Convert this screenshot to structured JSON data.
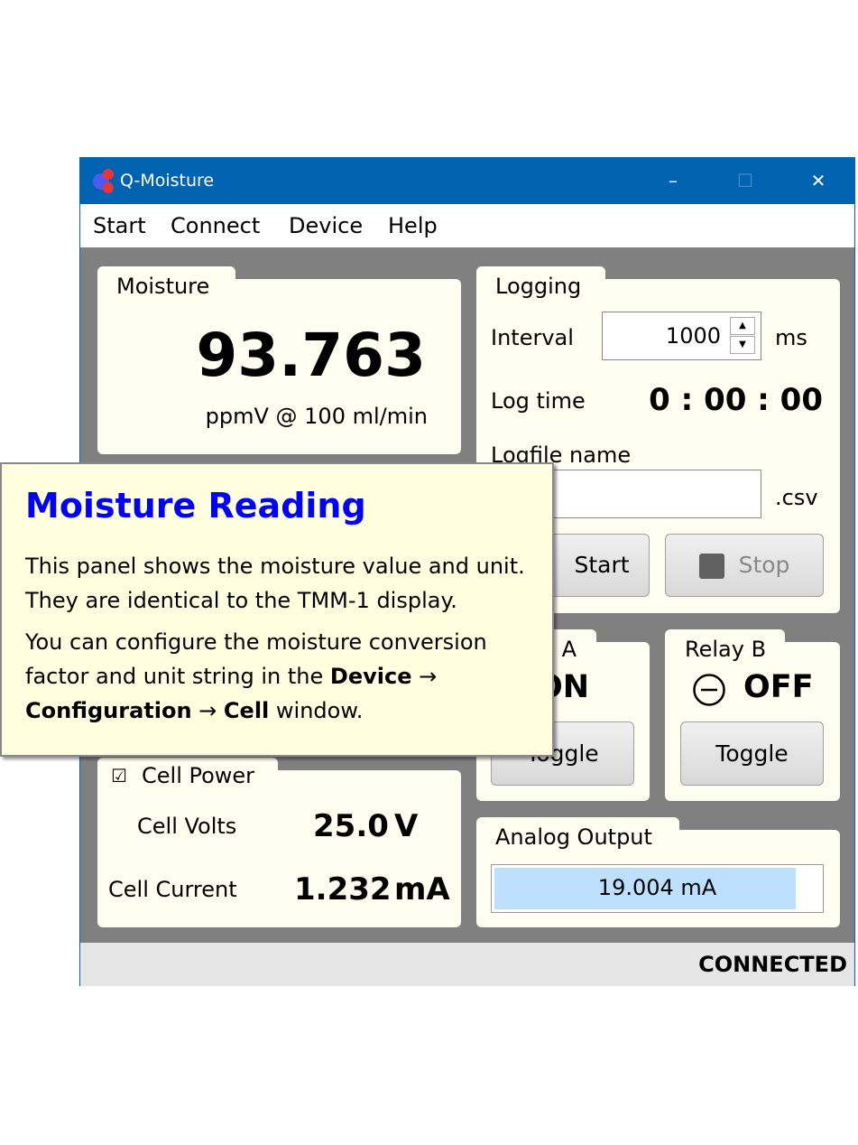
{
  "window": {
    "title": "Q-Moisture",
    "minimize": "–",
    "maximize": "☐",
    "close": "✕"
  },
  "menu": [
    "Start",
    "Connect",
    "Device",
    "Help"
  ],
  "moisture": {
    "label": "Moisture",
    "value": "93.763",
    "unit": "ppmV @ 100 ml/min"
  },
  "logging": {
    "label": "Logging",
    "interval_label": "Interval",
    "interval_value": "1000",
    "interval_unit": "ms",
    "logtime_label": "Log time",
    "logtime_value": "0 : 00 : 00",
    "logfile_label": "Logfile name",
    "logfile_value": "",
    "logfile_ext": ".csv",
    "start_label": "Start",
    "stop_label": "Stop"
  },
  "relay_a": {
    "label": "Relay A",
    "state": "ON",
    "toggle": "Toggle"
  },
  "relay_b": {
    "label": "Relay B",
    "state": "OFF",
    "toggle": "Toggle",
    "state_icon": "minus-circle-icon"
  },
  "cell": {
    "power_label": "Cell Power",
    "power_checked": true,
    "volts_label": "Cell Volts",
    "volts_value": "25.0",
    "volts_unit": "V",
    "current_label": "Cell Current",
    "current_value": "1.232",
    "current_unit": "mA"
  },
  "analog": {
    "label": "Analog Output",
    "value": "19.004 mA",
    "fill_percent": 92
  },
  "status": {
    "text": "CONNECTED"
  },
  "tooltip": {
    "title": "Moisture Reading",
    "p1": "This panel shows the moisture value and unit. They are identical to the TMM-1 display.",
    "p2_a": "You can configure the moisture conversion factor and unit string in the ",
    "p2_b": "Device",
    "p2_c": " → ",
    "p2_d": "Configuration",
    "p2_e": " → ",
    "p2_f": "Cell",
    "p2_g": " window."
  },
  "colors": {
    "titlebar": "#0063b1",
    "panel": "#fefef0",
    "background": "#808080",
    "tooltip_title": "#0000ff",
    "analog_fill": "#bde0ff"
  }
}
